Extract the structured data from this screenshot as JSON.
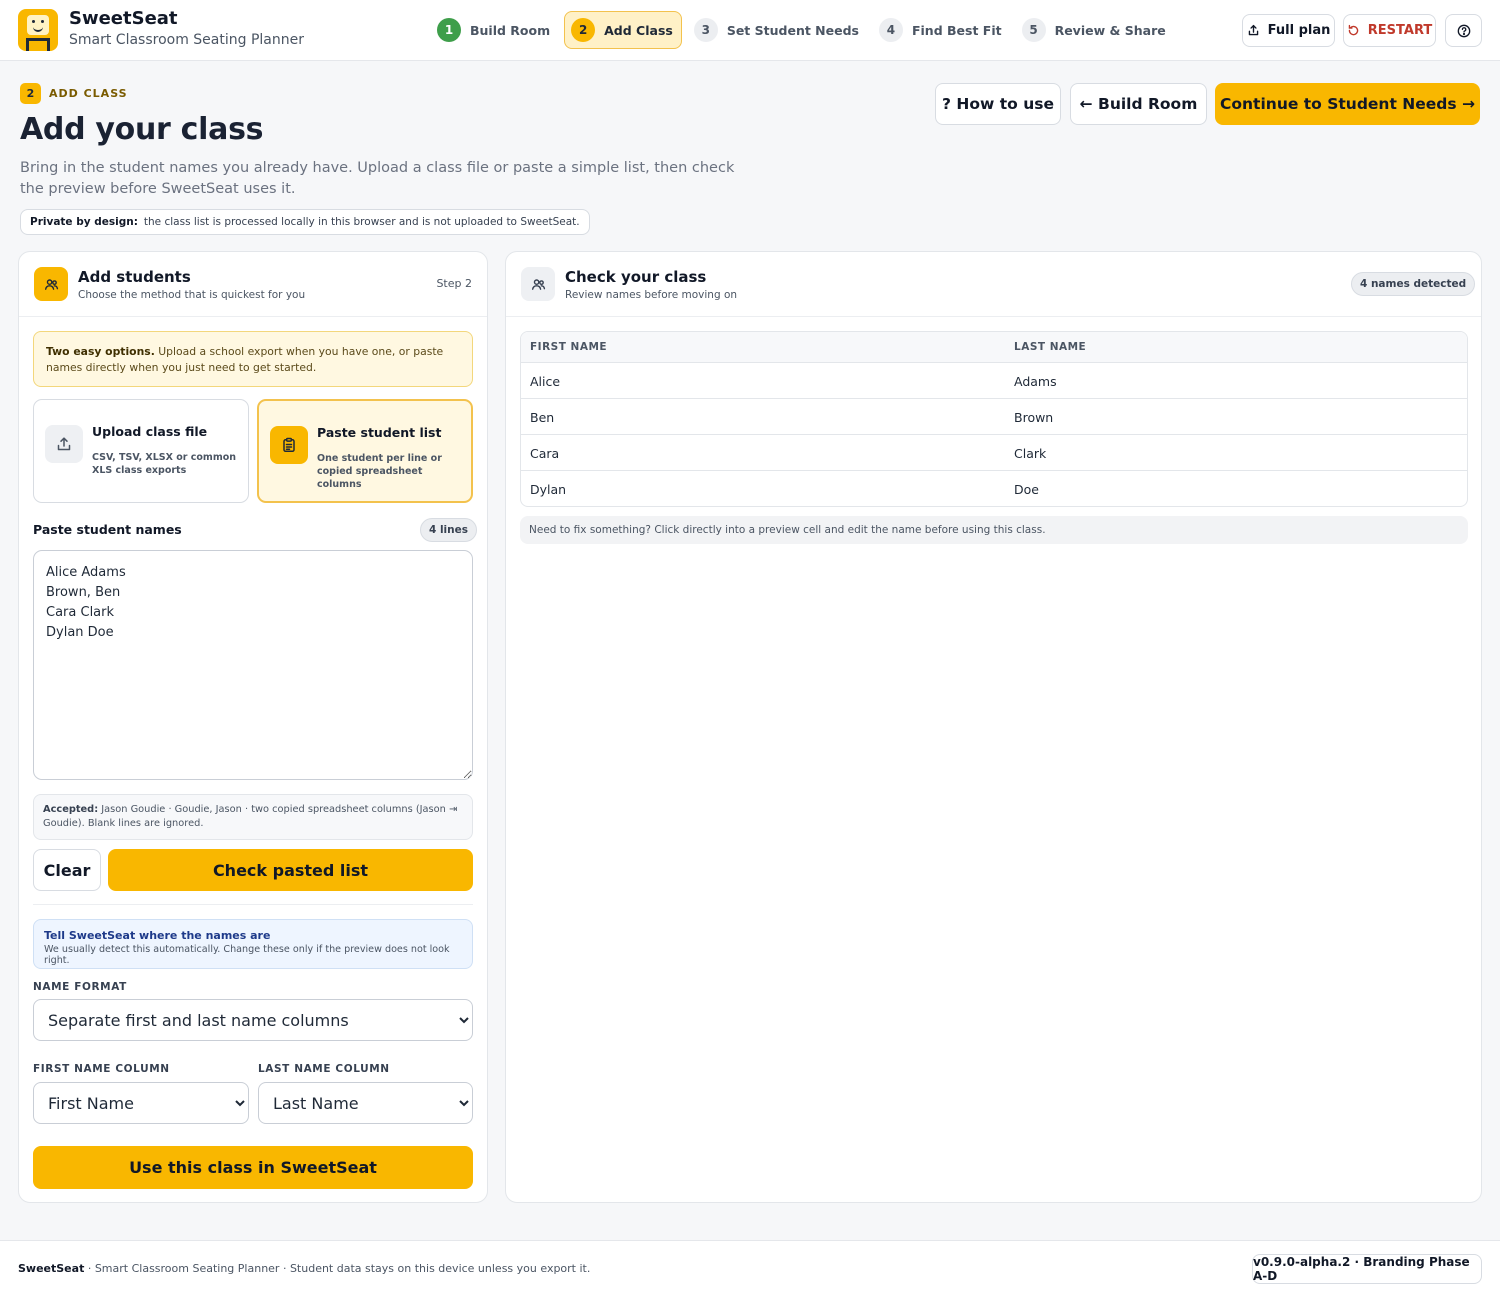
{
  "app": {
    "name": "SweetSeat",
    "subtitle": "Smart Classroom Seating Planner"
  },
  "steps": [
    {
      "num": "1",
      "label": "Build Room",
      "state": "done"
    },
    {
      "num": "2",
      "label": "Add Class",
      "state": "active"
    },
    {
      "num": "3",
      "label": "Set Student Needs",
      "state": "todo"
    },
    {
      "num": "4",
      "label": "Find Best Fit",
      "state": "todo"
    },
    {
      "num": "5",
      "label": "Review & Share",
      "state": "todo"
    }
  ],
  "header_actions": {
    "full_plan": "Full plan",
    "restart": "RESTART",
    "help_icon": "help-circle-icon"
  },
  "page": {
    "eyebrow_num": "2",
    "eyebrow": "ADD CLASS",
    "title": "Add your class",
    "description": "Bring in the student names you already have. Upload a class file or paste a simple list, then check the preview before SweetSeat uses it.",
    "privacy_bold": "Private by design:",
    "privacy_text": "the class list is processed locally in this browser and is not uploaded to SweetSeat.",
    "how_to_use": "? How to use",
    "back": "← Build Room",
    "continue": "Continue to Student Needs →"
  },
  "add_students": {
    "title": "Add students",
    "subtitle": "Choose the method that is quickest for you",
    "step": "Step 2",
    "note_bold": "Two easy options.",
    "note_text": "Upload a school export when you have one, or paste names directly when you just need to get started.",
    "options": [
      {
        "title": "Upload class file",
        "subtitle": "CSV, TSV, XLSX or common XLS class exports",
        "icon": "upload-icon",
        "selected": false
      },
      {
        "title": "Paste student list",
        "subtitle": "One student per line or copied spreadsheet columns",
        "icon": "clipboard-icon",
        "selected": true
      }
    ],
    "paste_label": "Paste student names",
    "lines_count": "4 lines",
    "paste_value": "Alice Adams\nBrown, Ben\nCara Clark\nDylan Doe",
    "accepted_bold": "Accepted:",
    "accepted_text": "Jason Goudie · Goudie, Jason · two copied spreadsheet columns (Jason ⇥ Goudie). Blank lines are ignored.",
    "clear": "Clear",
    "check": "Check pasted list",
    "info_title": "Tell SweetSeat where the names are",
    "info_sub": "We usually detect this automatically. Change these only if the preview does not look right.",
    "name_format_label": "NAME FORMAT",
    "name_format_value": "Separate first and last name columns",
    "first_col_label": "FIRST NAME COLUMN",
    "first_col_value": "First Name",
    "last_col_label": "LAST NAME COLUMN",
    "last_col_value": "Last Name",
    "use_class": "Use this class in SweetSeat"
  },
  "check_class": {
    "title": "Check your class",
    "subtitle": "Review names before moving on",
    "detected": "4 names detected",
    "columns": [
      "FIRST NAME",
      "LAST NAME"
    ],
    "rows": [
      [
        "Alice",
        "Adams"
      ],
      [
        "Ben",
        "Brown"
      ],
      [
        "Cara",
        "Clark"
      ],
      [
        "Dylan",
        "Doe"
      ]
    ],
    "fix_note": "Need to fix something? Click directly into a preview cell and edit the name before using this class."
  },
  "footer": {
    "brand": "SweetSeat",
    "text": " · Smart Classroom Seating Planner · Student data stays on this device unless you export it.",
    "version": "v0.9.0-alpha.2 · Branding Phase A-D"
  },
  "colors": {
    "accent": "#f9b700",
    "done_step": "#3e9e4a",
    "restart": "#c0392b"
  }
}
